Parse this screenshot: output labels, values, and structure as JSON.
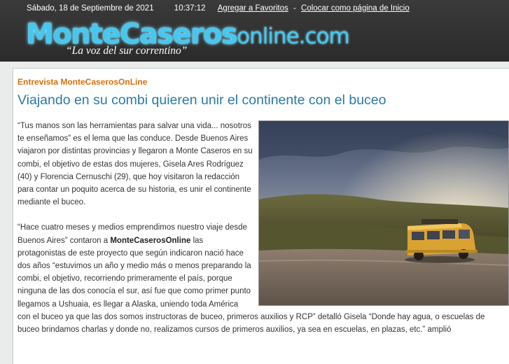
{
  "topbar": {
    "date": "Sábado, 18 de Septiembre de 2021",
    "time": "10:37:12",
    "favorites_link": "Agregar a Favoritos",
    "separator": "-",
    "homepage_link": "Colocar como página de Inicio"
  },
  "logo": {
    "main": "MonteCaseros",
    "suffix": "online.com",
    "slogan": "“La voz del sur correntino”"
  },
  "article": {
    "kicker": "Entrevista MonteCaserosOnLine",
    "title": "Viajando en su combi quieren unir el continente con el buceo",
    "p1": "“Tus manos son las herramientas para salvar una vida... nosotros te enseñamos” es el lema que las conduce. Desde Buenos Aires viajaron por distintas provincias y llegaron a Monte Caseros en su combi, el objetivo de estas dos mujeres, Gisela Ares Rodríguez (40) y Florencia Cernuschi (29), que hoy visitaron la redacción para contar un poquito acerca de su historia, es unir el continente mediante el buceo.",
    "p2_before": "“Hace cuatro meses y medios emprendimos nuestro viaje desde Buenos Aires” contaron a ",
    "p2_bold": "MonteCaserosOnline",
    "p2_after": " las protagonistas de este proyecto que según indicaron nació hace dos años “estuvimos un año y medio más o menos preparando la combi, el objetivo, recorriendo primeramente el país, porque ninguna de las dos conocía el sur, así fue que como primer punto llegamos a Ushuaia, es llegar a Alaska, uniendo toda América con el buceo ya que las dos somos instructoras de buceo, primeros auxilios y RCP” detalló Gisela “Donde hay agua, o escuelas de buceo brindamos charlas y donde no, realizamos cursos de primeros auxilios, ya sea en escuelas, en plazas, etc.” amplió"
  },
  "colors": {
    "header_bg": "#2e2e2e",
    "logo_blue": "#46c7f0",
    "kicker_orange": "#d7700e",
    "title_blue": "#2a7aa6",
    "van_yellow": "#e0a52c"
  }
}
